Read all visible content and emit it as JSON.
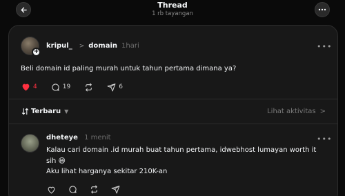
{
  "header": {
    "title": "Thread",
    "subtitle": "1 rb tayangan",
    "back_icon": "arrow-left-icon",
    "more_icon": "more-horizontal-icon"
  },
  "post": {
    "username": "kripul_",
    "tag": "domain",
    "time": "1hari",
    "text": "Beli domain id paling murah untuk tahun pertama dimana ya?",
    "likes": "4",
    "comments": "19",
    "shares": "6",
    "like_color": "#ff3040"
  },
  "sort": {
    "label": "Terbaru",
    "activity_label": "Lihat aktivitas"
  },
  "reply": {
    "username": "dheteye",
    "time": "1 menit",
    "line1": "Kalau cari domain .id murah buat tahun pertama, idwebhost lumayan worth it sih 😄",
    "line2": "Aku lihat harganya sekitar 210K-an"
  }
}
